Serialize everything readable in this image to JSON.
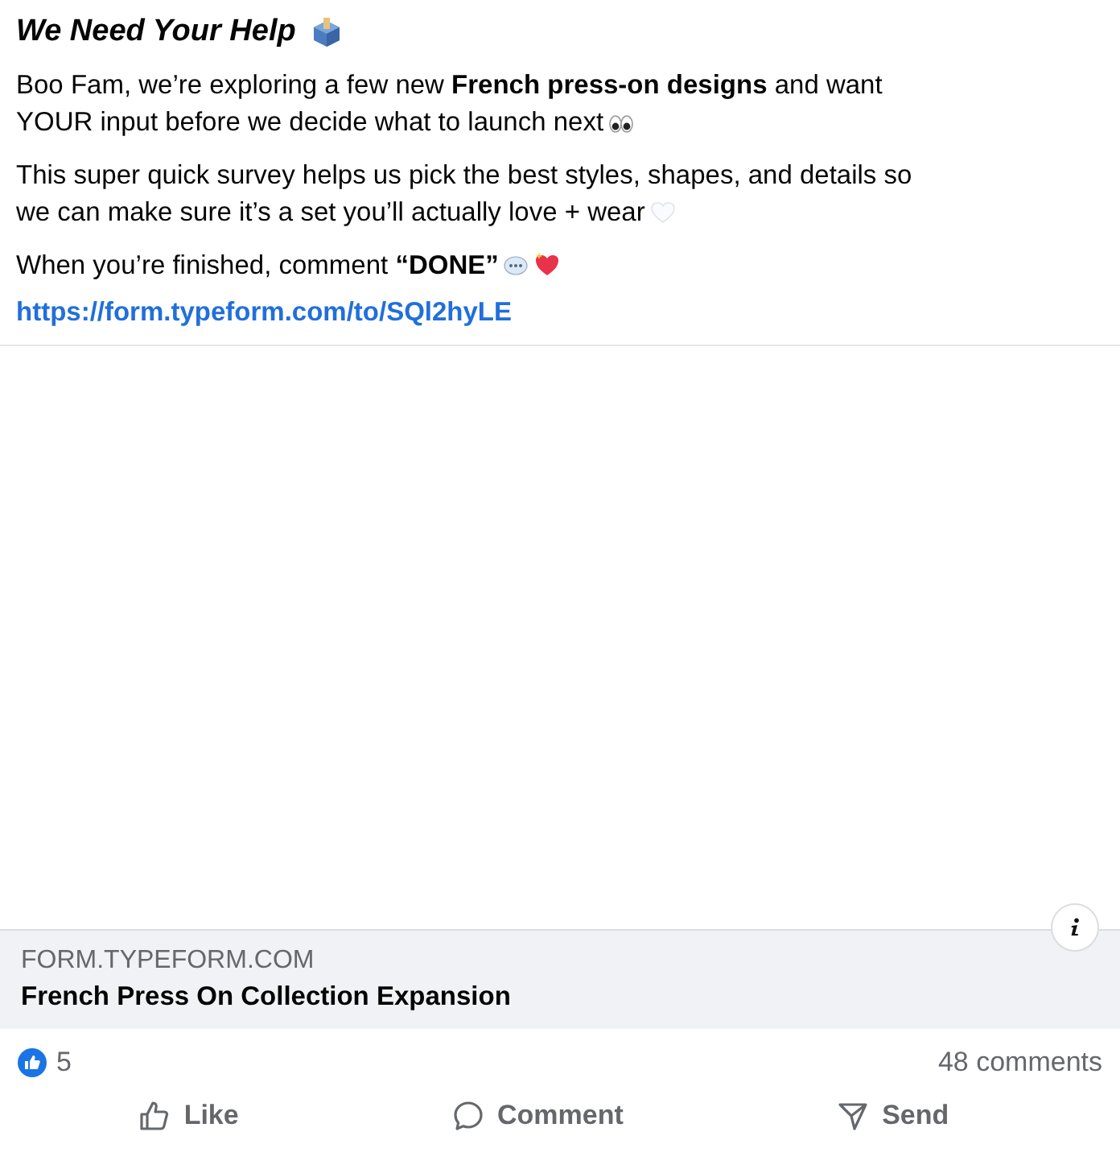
{
  "post": {
    "title": "We Need Your Help",
    "paragraphs": [
      {
        "lines": [
          "Boo Fam, we’re exploring a few new **French press-on designs** and want",
          "YOUR input before we decide what to launch next"
        ]
      },
      {
        "lines": [
          "This super quick survey helps us pick the best styles, shapes, and details so",
          "we can make sure it’s a set you’ll actually love + wear"
        ]
      },
      {
        "lines": [
          "When you’re finished, comment **“DONE”**"
        ]
      }
    ],
    "link": "https://form.typeform.com/to/SQl2hyLE"
  },
  "preview": {
    "domain": "FORM.TYPEFORM.COM",
    "title": "French Press On Collection Expansion"
  },
  "reactions": {
    "count": "5",
    "comments": "48 comments"
  },
  "actions": [
    {
      "kind": "like",
      "label": "Like"
    },
    {
      "kind": "comment",
      "label": "Comment"
    },
    {
      "kind": "send",
      "label": "Send"
    }
  ]
}
